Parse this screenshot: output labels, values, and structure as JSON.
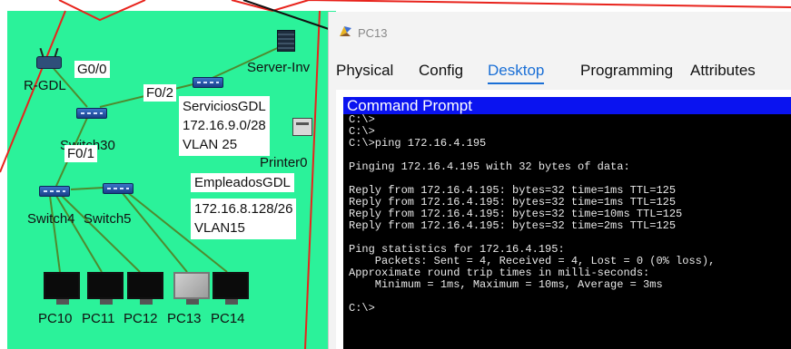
{
  "topology": {
    "devices": {
      "router": "R-GDL",
      "server": "Server-Inv",
      "printer": "Printer0",
      "switch_core": "Switch30",
      "switch4": "Switch4",
      "switch5": "Switch5",
      "pcs": [
        "PC10",
        "PC11",
        "PC12",
        "PC13",
        "PC14"
      ]
    },
    "ports": {
      "g00": "G0/0",
      "f02": "F0/2",
      "f01": "F0/1"
    },
    "networks": [
      {
        "name": "ServiciosGDL",
        "subnet": "172.16.9.0/28",
        "vlan": "VLAN 25"
      },
      {
        "name": "EmpleadosGDL",
        "subnet": "172.16.8.128/26",
        "vlan": "VLAN15"
      }
    ]
  },
  "window": {
    "title": "PC13",
    "tabs": [
      {
        "label": "Physical",
        "active": false
      },
      {
        "label": "Config",
        "active": false
      },
      {
        "label": "Desktop",
        "active": true
      },
      {
        "label": "Programming",
        "active": false
      },
      {
        "label": "Attributes",
        "active": false
      }
    ],
    "command_prompt_title": "Command Prompt",
    "console_lines": [
      "C:\\>",
      "C:\\>",
      "C:\\>ping 172.16.4.195",
      "",
      "Pinging 172.16.4.195 with 32 bytes of data:",
      "",
      "Reply from 172.16.4.195: bytes=32 time=1ms TTL=125",
      "Reply from 172.16.4.195: bytes=32 time=1ms TTL=125",
      "Reply from 172.16.4.195: bytes=32 time=10ms TTL=125",
      "Reply from 172.16.4.195: bytes=32 time=2ms TTL=125",
      "",
      "Ping statistics for 172.16.4.195:",
      "    Packets: Sent = 4, Received = 4, Lost = 0 (0% loss),",
      "Approximate round trip times in milli-seconds:",
      "    Minimum = 1ms, Maximum = 10ms, Average = 3ms",
      "",
      "C:\\>"
    ]
  },
  "colors": {
    "canvas_background": "#2bf29a",
    "wan_link": "#e8231c",
    "lan_link": "#4f8a2e",
    "active_tab": "#1a6fd6",
    "command_prompt_bar": "#0a13f0",
    "console_background": "#000000",
    "console_text": "#e8e8e8"
  }
}
